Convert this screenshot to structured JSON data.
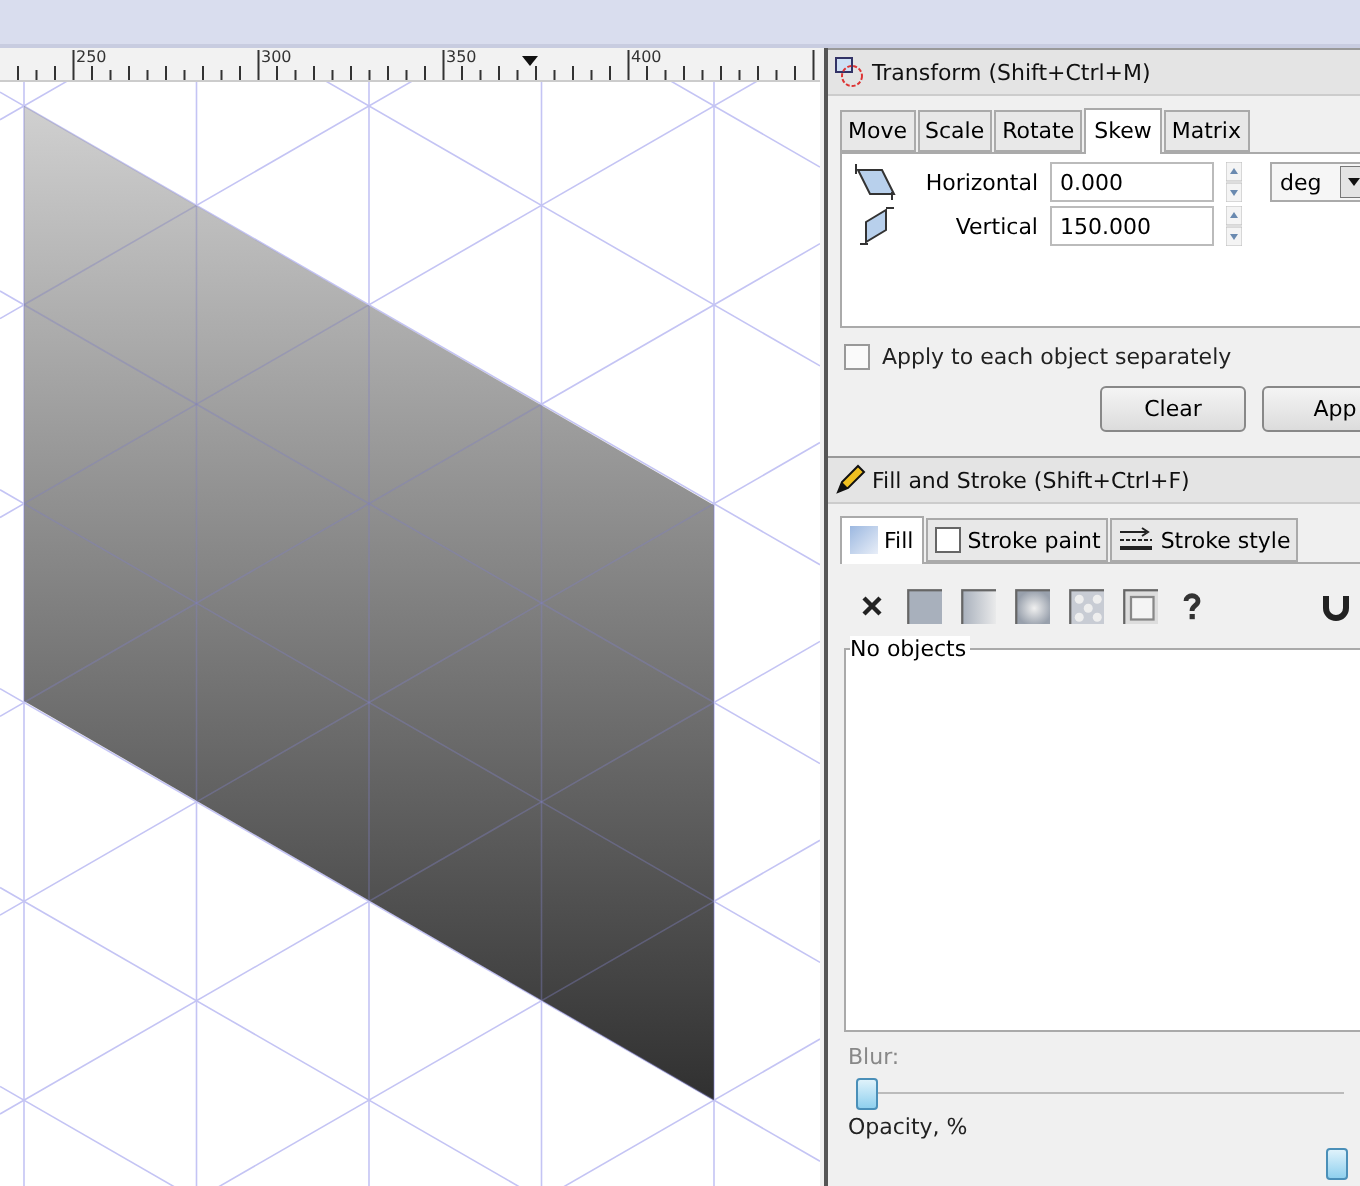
{
  "ruler": {
    "labels": [
      "250",
      "300",
      "350",
      "400"
    ]
  },
  "transform": {
    "title": "Transform (Shift+Ctrl+M)",
    "tabs": [
      {
        "label": "Move",
        "selected": false
      },
      {
        "label": "Scale",
        "selected": false
      },
      {
        "label": "Rotate",
        "selected": false
      },
      {
        "label": "Skew",
        "selected": true
      },
      {
        "label": "Matrix",
        "selected": false
      }
    ],
    "fields": [
      {
        "label": "Horizontal",
        "value": "0.000",
        "kind": "horizontal"
      },
      {
        "label": "Vertical",
        "value": "150.000",
        "kind": "vertical"
      }
    ],
    "unit": "deg",
    "apply_each": {
      "label": "Apply to each object separately",
      "checked": false
    },
    "buttons": [
      "Clear",
      "App"
    ]
  },
  "fill_stroke": {
    "title": "Fill and Stroke (Shift+Ctrl+F)",
    "tabs": [
      {
        "label": "Fill",
        "selected": true,
        "kind": "fill"
      },
      {
        "label": "Stroke paint",
        "selected": false,
        "kind": "paint"
      },
      {
        "label": "Stroke style",
        "selected": false,
        "kind": "style"
      }
    ],
    "paint_types": [
      {
        "kind": "none"
      },
      {
        "kind": "flat"
      },
      {
        "kind": "linear"
      },
      {
        "kind": "radial"
      },
      {
        "kind": "pattern"
      },
      {
        "kind": "swatch"
      },
      {
        "kind": "unset"
      }
    ],
    "frame_label": "No objects",
    "blur": {
      "label": "Blur:",
      "level": 0
    },
    "opacity": {
      "label": "Opacity, %",
      "level": 1
    }
  }
}
